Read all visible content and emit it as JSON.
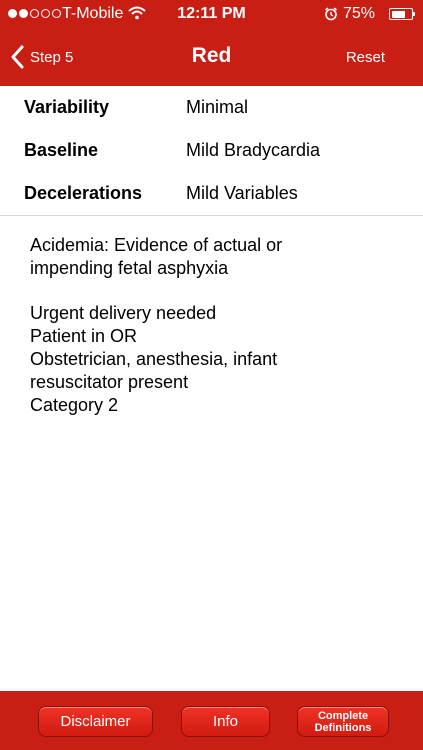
{
  "status_bar": {
    "carrier": "T-Mobile",
    "time": "12:11 PM",
    "battery": "75%",
    "battery_level": 0.75,
    "signal_bars": 2
  },
  "nav": {
    "back_label": "Step 5",
    "title": "Red",
    "reset_label": "Reset"
  },
  "rows": [
    {
      "label": "Variability",
      "value": "Minimal"
    },
    {
      "label": "Baseline",
      "value": "Mild Bradycardia"
    },
    {
      "label": "Decelerations",
      "value": "Mild Variables"
    }
  ],
  "description": {
    "paragraph1": [
      "Acidemia: Evidence of actual or",
      "impending fetal asphyxia"
    ],
    "paragraph2": [
      "Urgent delivery needed",
      "Patient in OR",
      "Obstetrician, anesthesia, infant",
      "resuscitator present",
      "Category 2"
    ]
  },
  "footer": {
    "disclaimer_label": "Disclaimer",
    "info_label": "Info",
    "complete_label_line1": "Complete",
    "complete_label_line2": "Definitions"
  },
  "colors": {
    "accent": "#c81e14"
  }
}
